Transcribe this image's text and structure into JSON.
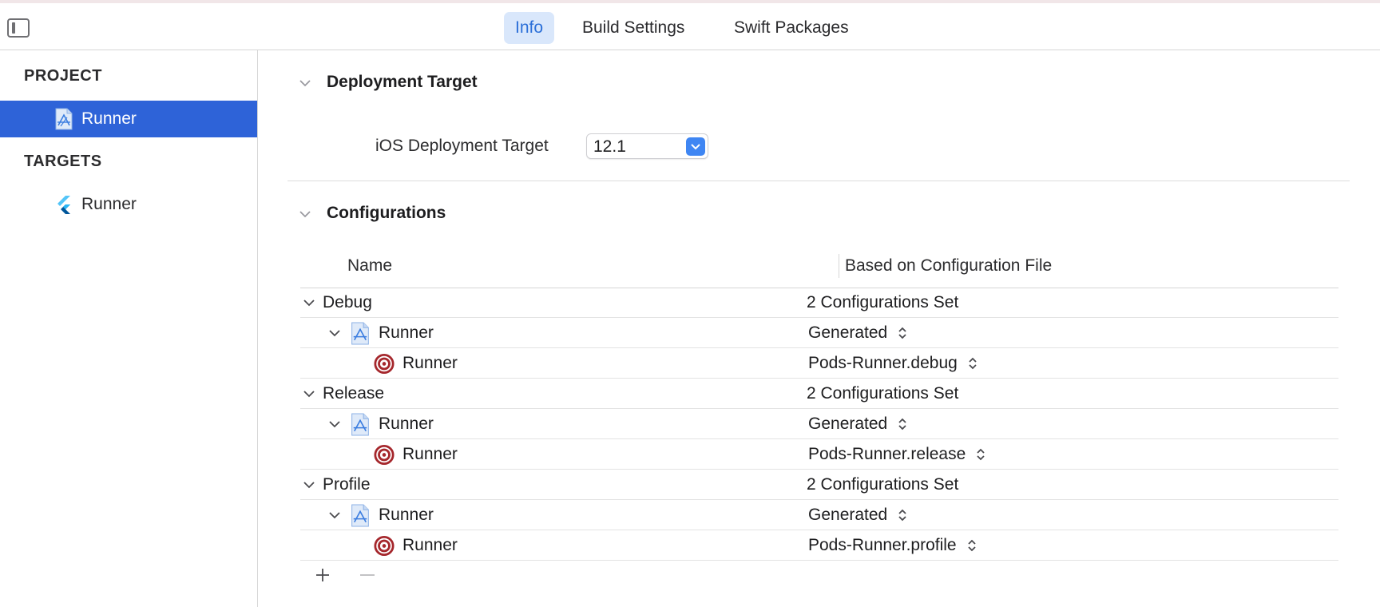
{
  "tabs": [
    {
      "label": "Info",
      "active": true
    },
    {
      "label": "Build Settings",
      "active": false
    },
    {
      "label": "Swift Packages",
      "active": false
    }
  ],
  "sidebar": {
    "project_header": "PROJECT",
    "project_item": {
      "label": "Runner",
      "icon": "xcode-project-icon",
      "selected": true
    },
    "targets_header": "TARGETS",
    "target_item": {
      "label": "Runner",
      "icon": "flutter-icon",
      "selected": false
    }
  },
  "deployment": {
    "title": "Deployment Target",
    "label": "iOS Deployment Target",
    "value": "12.1"
  },
  "configurations": {
    "title": "Configurations",
    "columns": {
      "name": "Name",
      "file": "Based on Configuration File"
    },
    "groups": [
      {
        "name": "Debug",
        "summary": "2 Configurations Set",
        "project": {
          "name": "Runner",
          "file": "Generated"
        },
        "target": {
          "name": "Runner",
          "file": "Pods-Runner.debug"
        }
      },
      {
        "name": "Release",
        "summary": "2 Configurations Set",
        "project": {
          "name": "Runner",
          "file": "Generated"
        },
        "target": {
          "name": "Runner",
          "file": "Pods-Runner.release"
        }
      },
      {
        "name": "Profile",
        "summary": "2 Configurations Set",
        "project": {
          "name": "Runner",
          "file": "Generated"
        },
        "target": {
          "name": "Runner",
          "file": "Pods-Runner.profile"
        }
      }
    ]
  },
  "colors": {
    "accent": "#2e63d8",
    "tab_active_bg": "#d9e7fb",
    "target_icon": "#a5272c"
  }
}
